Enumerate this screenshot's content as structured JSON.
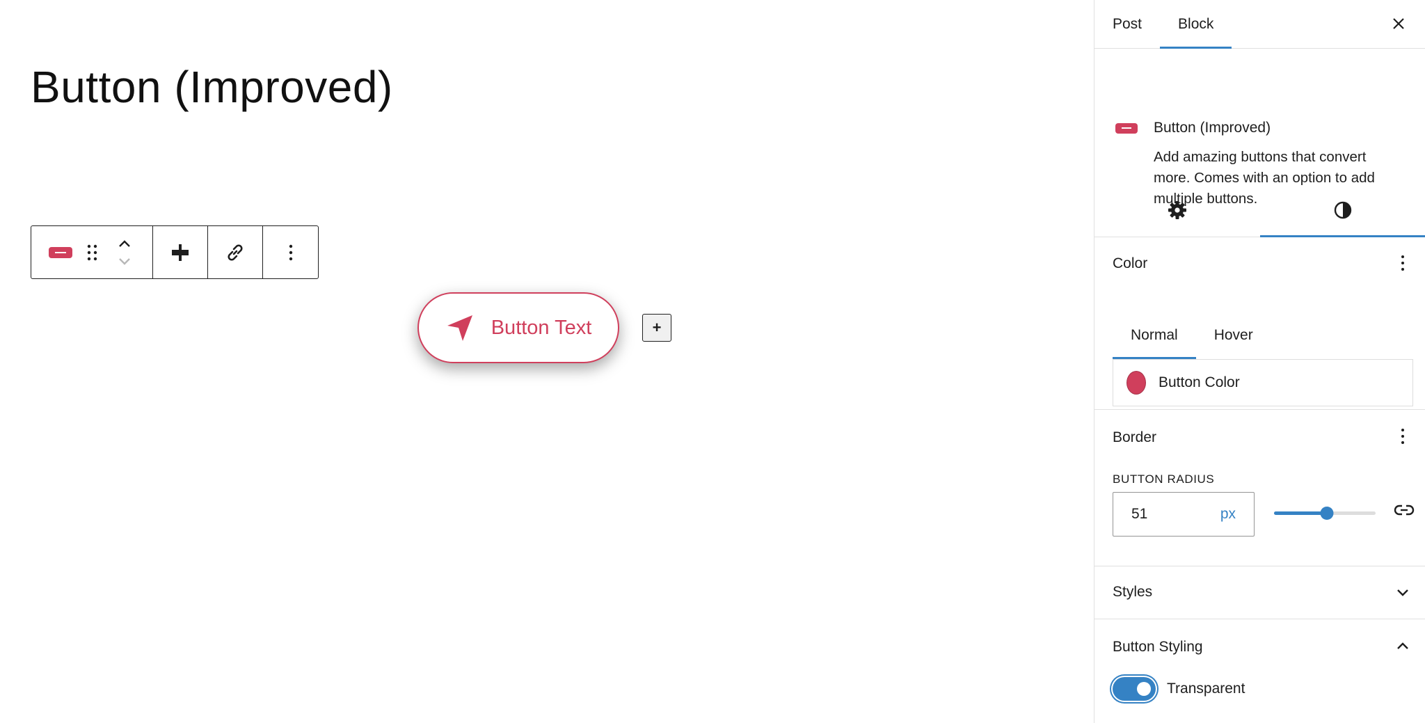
{
  "editor": {
    "post_title": "Button (Improved)",
    "button_text": "Button Text",
    "inserter_label": "+"
  },
  "toolbar": {
    "icons": [
      "block-type-icon",
      "drag-handle-icon",
      "chevron-up-icon",
      "chevron-down-icon",
      "align-icon",
      "link-icon",
      "more-vertical-icon"
    ]
  },
  "sidebar": {
    "tabs": [
      {
        "label": "Post",
        "active": false
      },
      {
        "label": "Block",
        "active": true
      }
    ],
    "block_card": {
      "title": "Button (Improved)",
      "description": "Add amazing buttons that convert more. Comes with an option to add multiple buttons."
    },
    "inspector_tabs": [
      "gear-icon",
      "contrast-icon"
    ],
    "color_panel": {
      "title": "Color",
      "tabs": [
        {
          "label": "Normal",
          "active": true
        },
        {
          "label": "Hover",
          "active": false
        }
      ],
      "items": [
        {
          "label": "Button Color",
          "color": "#d03f5c"
        }
      ]
    },
    "border_panel": {
      "title": "Border",
      "radius_label": "BUTTON RADIUS",
      "radius_value": "51",
      "radius_unit": "px",
      "slider_fraction": 0.52
    },
    "styles_panel": {
      "title": "Styles"
    },
    "button_styling_panel": {
      "title": "Button Styling",
      "toggle_label": "Transparent",
      "toggle_on": true
    }
  },
  "colors": {
    "accent": "#3582c4",
    "brand": "#d03f5c"
  }
}
